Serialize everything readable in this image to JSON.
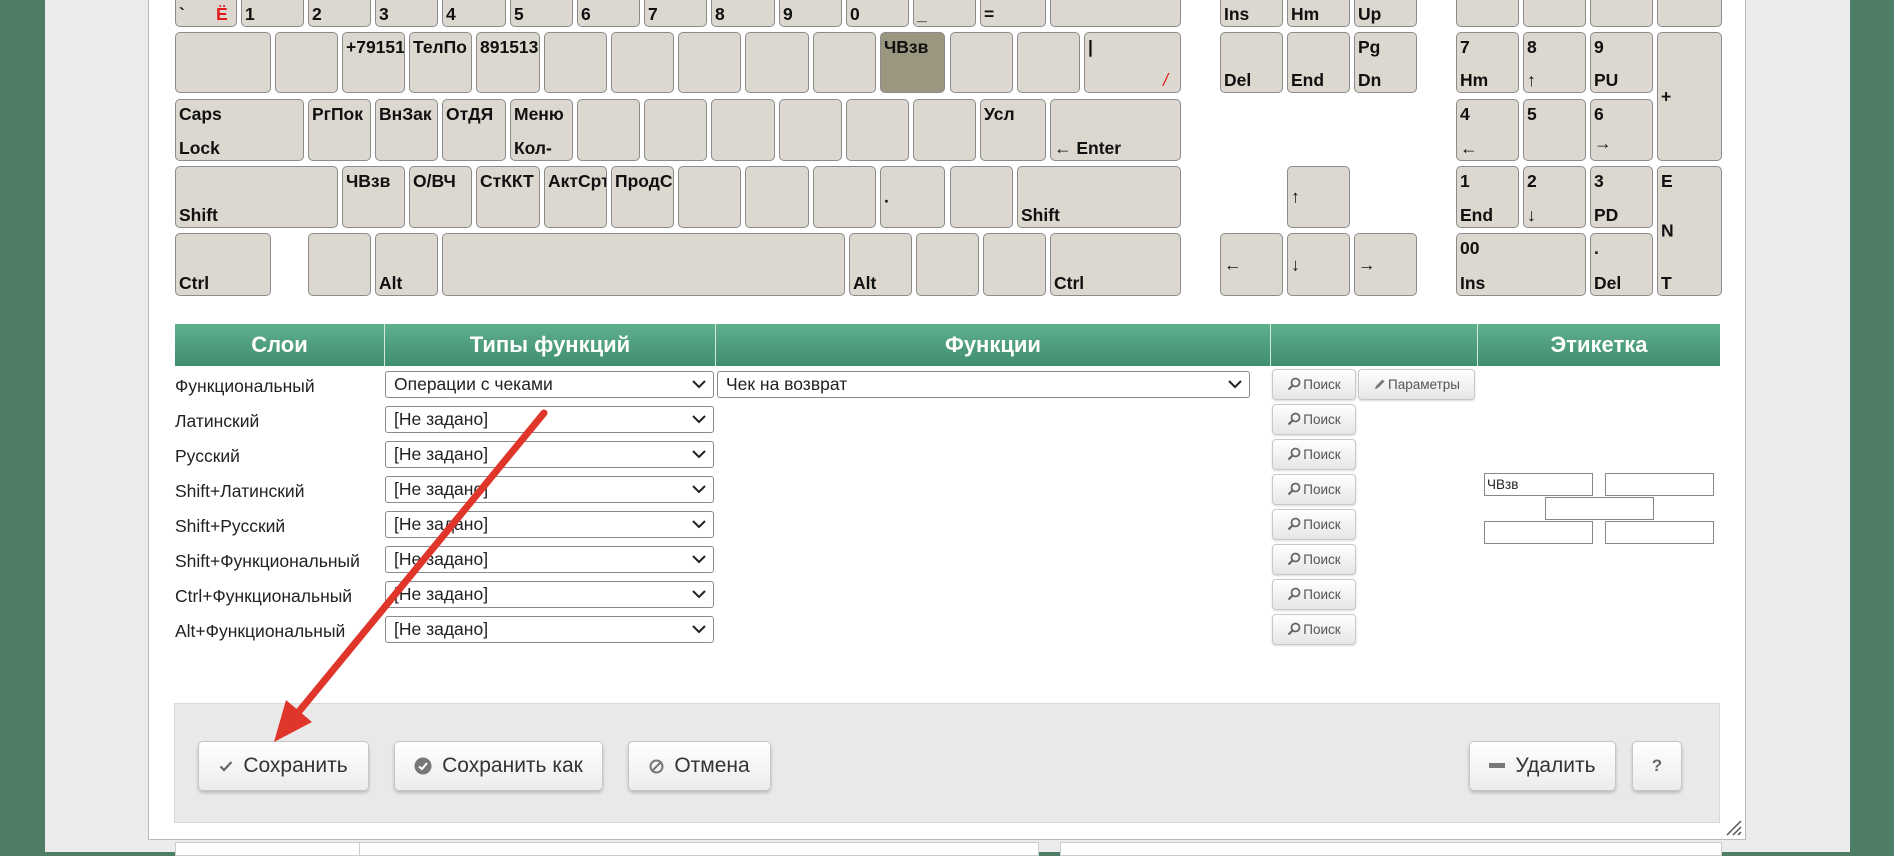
{
  "keyboard": {
    "row1": [
      "`",
      "Ё",
      "1",
      "2",
      "3",
      "4",
      "5",
      "6",
      "7",
      "8",
      "9",
      "0",
      "_",
      "="
    ],
    "row1_nav": [
      "Ins",
      "Hm",
      "Up"
    ],
    "row2": [
      "+79151",
      "ТелПо",
      "891513",
      "ЧВзв",
      "|",
      "/"
    ],
    "row2_nav": [
      [
        "Del",
        ""
      ],
      [
        "End",
        ""
      ],
      [
        "Pg",
        "Dn"
      ]
    ],
    "row2_num": [
      [
        "7",
        "Hm"
      ],
      [
        "8",
        "↑"
      ],
      [
        "9",
        "PU"
      ],
      "+"
    ],
    "caps": [
      "Caps",
      "Lock"
    ],
    "row3": [
      "РгПок",
      "ВнЗак",
      "ОтДЯ",
      "Меню",
      "Кол-",
      "Усл",
      "← Enter"
    ],
    "row3_num": [
      [
        "4",
        "←"
      ],
      [
        "5",
        ""
      ],
      [
        "6",
        "→"
      ]
    ],
    "shift": "Shift",
    "row4": [
      "ЧВзв",
      "О/ВЧ",
      "СтККТ",
      "АктСрт",
      "ПродСр",
      "."
    ],
    "row4_nav": "↑",
    "row4_num": [
      [
        "1",
        "End"
      ],
      [
        "2",
        "↓"
      ],
      [
        "3",
        "PD"
      ],
      [
        "E",
        "N",
        "T"
      ]
    ],
    "ctrl": "Ctrl",
    "alt": "Alt",
    "row5_nav": [
      "←",
      "↓",
      "→"
    ],
    "row5_num": [
      [
        "00",
        "Ins"
      ],
      [
        ".",
        "Del"
      ]
    ]
  },
  "table": {
    "headers": [
      "Слои",
      "Типы функций",
      "Функции",
      "",
      "Этикетка"
    ],
    "rows": [
      {
        "layer": "Функциональный",
        "type": "Операции с чеками",
        "function": "Чек на возврат"
      },
      {
        "layer": "Латинский",
        "type": "[Не задано]"
      },
      {
        "layer": "Русский",
        "type": "[Не задано]"
      },
      {
        "layer": "Shift+Латинский",
        "type": "[Не задано]"
      },
      {
        "layer": "Shift+Русский",
        "type": "[Не задано]"
      },
      {
        "layer": "Shift+Функциональный",
        "type": "[Не задано]"
      },
      {
        "layer": "Ctrl+Функциональный",
        "type": "[Не задано]"
      },
      {
        "layer": "Alt+Функциональный",
        "type": "[Не задано]"
      }
    ],
    "search_label": "Поиск",
    "params_label": "Параметры"
  },
  "label_inputs": {
    "top_left": "ЧВзв"
  },
  "footer": {
    "save": "Сохранить",
    "save_as": "Сохранить как",
    "cancel": "Отмена",
    "delete": "Удалить",
    "help": "?"
  },
  "colors": {
    "background": "#4e7e66",
    "header_green": "#4f9f7e",
    "key_face": "#dcd8cf",
    "key_selected": "#9b9680",
    "arrow_red": "#e0352b"
  }
}
